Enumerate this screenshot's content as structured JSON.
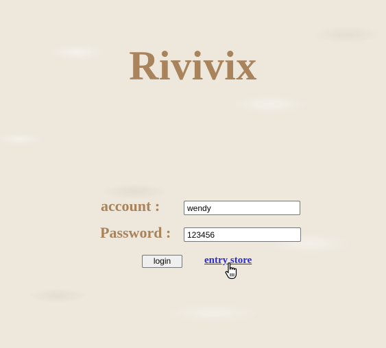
{
  "app": {
    "title": "Rivivix"
  },
  "form": {
    "account_label": "account :",
    "account_value": "wendy",
    "password_label": "Password :",
    "password_value": "123456",
    "login_label": "login",
    "entry_link_label": "entry store"
  },
  "colors": {
    "title": "#a8835c",
    "label": "#a8835c",
    "link": "#2b2bd6",
    "background": "#ede7dc"
  },
  "icons": {
    "cursor": "hand-pointer-icon"
  }
}
